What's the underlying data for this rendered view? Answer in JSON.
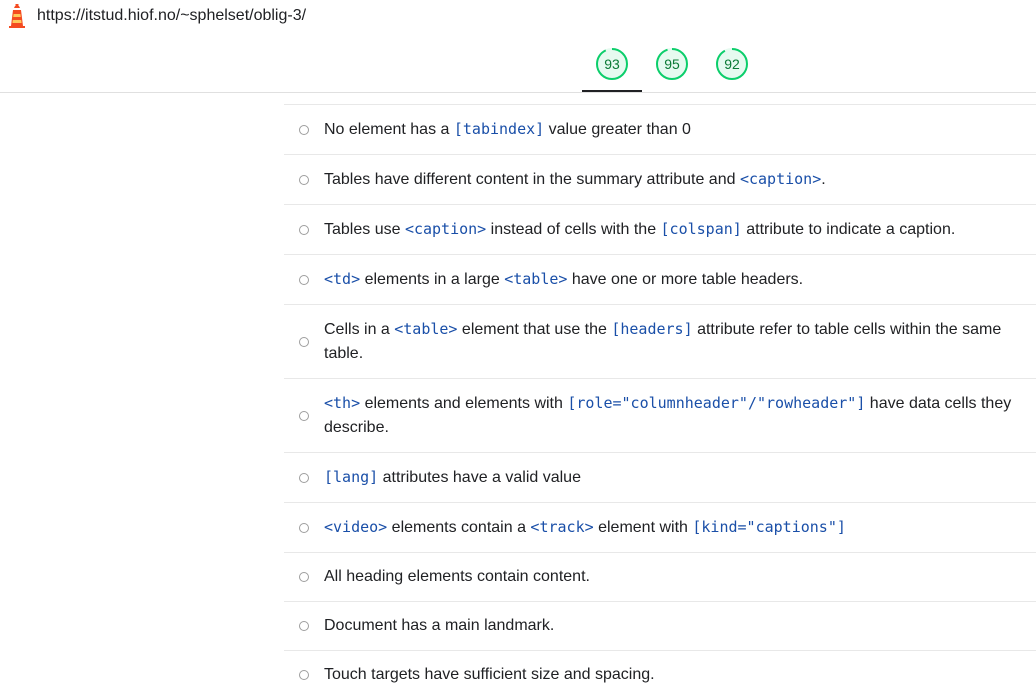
{
  "browser": {
    "url": "https://itstud.hiof.no/~sphelset/oblig-3/",
    "icon": "lighthouse-icon"
  },
  "scores": [
    {
      "value": "93",
      "score": 93
    },
    {
      "value": "95",
      "score": 95
    },
    {
      "value": "92",
      "score": 92
    }
  ],
  "audits": [
    [
      {
        "t": "No element has a "
      },
      {
        "c": "[tabindex]"
      },
      {
        "t": " value greater than 0"
      }
    ],
    [
      {
        "t": "Tables have different content in the summary attribute and "
      },
      {
        "c": "<caption>"
      },
      {
        "t": "."
      }
    ],
    [
      {
        "t": "Tables use "
      },
      {
        "c": "<caption>"
      },
      {
        "t": " instead of cells with the "
      },
      {
        "c": "[colspan]"
      },
      {
        "t": " attribute to indicate a caption."
      }
    ],
    [
      {
        "c": "<td>"
      },
      {
        "t": " elements in a large "
      },
      {
        "c": "<table>"
      },
      {
        "t": " have one or more table headers."
      }
    ],
    [
      {
        "t": "Cells in a "
      },
      {
        "c": "<table>"
      },
      {
        "t": " element that use the "
      },
      {
        "c": "[headers]"
      },
      {
        "t": " attribute refer to table cells within the same table."
      }
    ],
    [
      {
        "c": "<th>"
      },
      {
        "t": " elements and elements with "
      },
      {
        "c": "[role=\"columnheader\"/\"rowheader\"]"
      },
      {
        "t": " have data cells they describe."
      }
    ],
    [
      {
        "c": "[lang]"
      },
      {
        "t": " attributes have a valid value"
      }
    ],
    [
      {
        "c": "<video>"
      },
      {
        "t": " elements contain a "
      },
      {
        "c": "<track>"
      },
      {
        "t": " element with "
      },
      {
        "c": "[kind=\"captions\"]"
      }
    ],
    [
      {
        "t": "All heading elements contain content."
      }
    ],
    [
      {
        "t": "Document has a main landmark."
      }
    ],
    [
      {
        "t": "Touch targets have sufficient size and spacing."
      }
    ]
  ],
  "colors": {
    "pass": "#0cce6b",
    "pass_text": "#0a7a35",
    "code": "#1a4fa8"
  }
}
